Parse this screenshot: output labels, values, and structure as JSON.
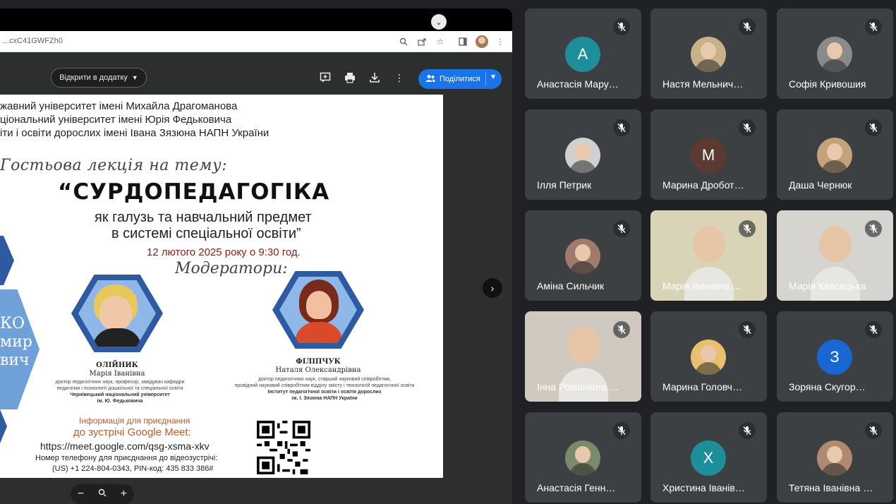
{
  "browser": {
    "url": "...cxC41GWFZh0"
  },
  "viewer": {
    "open_with_label": "Відкрити в додатку",
    "share_label": "Поділитися"
  },
  "poster": {
    "org_lines": [
      "жавний університет імені Михайла Драгоманова",
      "ціональний університет імені Юрія Федьковича",
      "іти і освіти дорослих імені Івана Зязюна НАПН України"
    ],
    "guest_title": "Гостьова лекція на тему:",
    "main_title": "“СУРДОПЕДАГОГІКА",
    "subtitle_1": "як галузь та навчальний предмет",
    "subtitle_2": "в системі спеціальної освіти”",
    "date": "12 лютого 2025 року о 9:30 год.",
    "moderators_title": "Модератори:",
    "left_speaker_lines": [
      "КО",
      "мир",
      "вич"
    ],
    "moderator_1": {
      "surname": "ОЛІЙНИК",
      "name": "Марія Іванівна",
      "desc_1": "доктор педагогічних наук, професор, завідувач кафедри",
      "desc_2": "педагогіки і психології дошкільної та спеціальної освіти",
      "inst_1": "Чернівецький національний університет",
      "inst_2": "ім. Ю. Федьковича"
    },
    "moderator_2": {
      "surname": "ФІЛІПЧУК",
      "name": "Наталя Олександрівна",
      "desc_1": "доктор педагогічних наук, старший науковий співробітник,",
      "desc_2": "провідний науковий співробітник відділу змісту і технологій педагогічної освіти",
      "inst_1": "Інститут педагогічної освіти і освіти дорослих",
      "inst_2": "ім. І. Зязюна НАПН України"
    },
    "info_1": "Інформація для приєднання",
    "info_2": "до зустрічі Google Meet:",
    "meet_link": "https://meet.google.com/qsg-xsma-xkv",
    "phone_1": "Номер телефону для приєднання до відеозустрічі:",
    "phone_2": "(US) +1 224-804-0343, PIN-код: 435 833 386#"
  },
  "participants": [
    {
      "name": "Анастасія Мару…",
      "initial": "А",
      "color": "#1e8e9a",
      "kind": "letter"
    },
    {
      "name": "Настя Мельнич…",
      "initial": "",
      "color": "#c9b28a",
      "kind": "photo"
    },
    {
      "name": "Софія Кривошия",
      "initial": "",
      "color": "#8a8a8a",
      "kind": "photo"
    },
    {
      "name": "Ілля Петрик",
      "initial": "",
      "color": "#d0d0d0",
      "kind": "photo"
    },
    {
      "name": "Марина Дробот…",
      "initial": "М",
      "color": "#5d3a31",
      "kind": "letter"
    },
    {
      "name": "Даша Чернюк",
      "initial": "",
      "color": "#c6a27a",
      "kind": "photo"
    },
    {
      "name": "Аміна Сильчик",
      "initial": "",
      "color": "#a07a6a",
      "kind": "photo"
    },
    {
      "name": "Марія Іванівна …",
      "initial": "",
      "color": "#d9d4b8",
      "kind": "video"
    },
    {
      "name": "Марія Квасецька",
      "initial": "",
      "color": "#d6d4d0",
      "kind": "video"
    },
    {
      "name": "Інна Романівна …",
      "initial": "",
      "color": "#cfc9c0",
      "kind": "video"
    },
    {
      "name": "Марина Головч…",
      "initial": "",
      "color": "#e8c070",
      "kind": "photo"
    },
    {
      "name": "Зоряна Скугор…",
      "initial": "З",
      "color": "#1967d2",
      "kind": "letter"
    },
    {
      "name": "Анастасія Генн…",
      "initial": "",
      "color": "#7a8a6a",
      "kind": "photo"
    },
    {
      "name": "Христина Іванів…",
      "initial": "Х",
      "color": "#1e8e9a",
      "kind": "letter"
    },
    {
      "name": "Тетяна Іванівна …",
      "initial": "",
      "color": "#b08a70",
      "kind": "photo"
    }
  ]
}
